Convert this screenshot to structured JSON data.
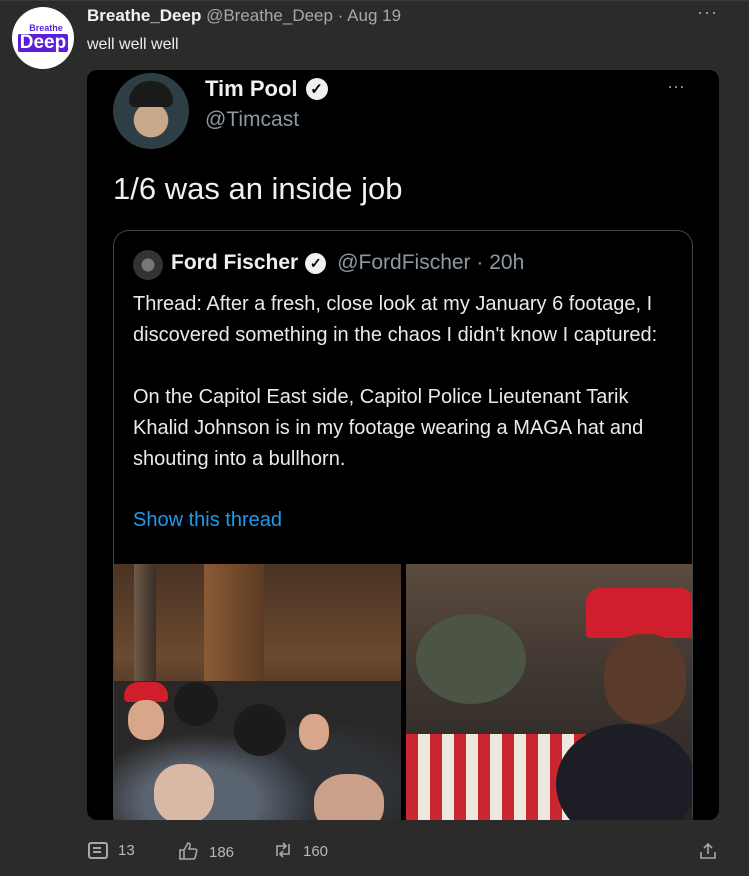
{
  "post": {
    "author": "Breathe_Deep",
    "handle": "@Breathe_Deep",
    "date": "Aug 19",
    "separator": "·",
    "text": "well well well",
    "avatar_top": "Breathe",
    "avatar_bottom": "Deep",
    "more": "···"
  },
  "embed": {
    "author": "Tim Pool",
    "handle": "@Timcast",
    "more": "···",
    "text": "1/6 was an inside job",
    "quote": {
      "author": "Ford Fischer",
      "handle": "@FordFischer",
      "time": "20h",
      "separator": "·",
      "paragraph1": "Thread: After a fresh, close look at my January 6 footage, I discovered something in the chaos I didn't know I captured:",
      "paragraph2": "On the Capitol East side, Capitol Police Lieutenant Tarik Khalid Johnson is in my footage wearing a MAGA hat and shouting into a bullhorn.",
      "link": "Show this thread"
    }
  },
  "footer": {
    "comments": "13",
    "likes": "186",
    "retweets": "160"
  },
  "colors": {
    "background": "#2b2b2b",
    "link": "#1d9bf0",
    "brand": "#5a1fd6"
  }
}
